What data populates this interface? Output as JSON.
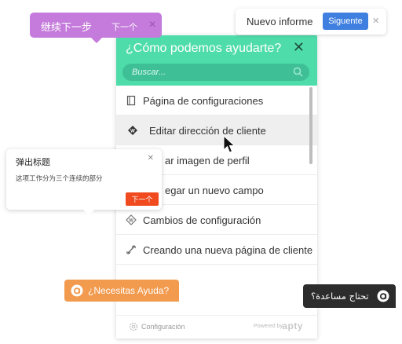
{
  "panel": {
    "title": "¿Cómo podemos ayudarte?",
    "close": "✕",
    "search_placeholder": "Buscar...",
    "items": [
      {
        "label": "Página de configuraciones",
        "icon": "page-icon"
      },
      {
        "label": "Editar dirección de cliente",
        "icon": "walkthrough-icon"
      },
      {
        "label": "ar imagen de perfil",
        "icon": "none"
      },
      {
        "label": "egar un nuevo campo",
        "icon": "none"
      },
      {
        "label": "Cambios de configuración",
        "icon": "walkthrough-icon"
      },
      {
        "label": "Creando una nueva página de cliente",
        "icon": "link-icon"
      }
    ],
    "footer": {
      "config_label": "Configuración",
      "powered_by": "Powered by",
      "brand": "apty"
    }
  },
  "purple_tooltip": {
    "text": "继续下一步",
    "next_label": "下一个",
    "close": "✕"
  },
  "informe_pill": {
    "text": "Nuevo informe",
    "next_label": "Siguente",
    "close": "✕"
  },
  "popup_card": {
    "title": "弹出标题",
    "body": "这项工作分为三个连续的部分",
    "next_label": "下一个",
    "close": "✕"
  },
  "help_buttons": {
    "orange_label": "¿Necesitas Ayuda?",
    "dark_label": "تحتاج مساعدة؟"
  },
  "colors": {
    "header": "#4fdcab",
    "purple": "#c47bdb",
    "blue": "#3f7fe0",
    "red_orange": "#f04a1e",
    "orange": "#f29a4e",
    "dark": "#2c2c2c"
  }
}
